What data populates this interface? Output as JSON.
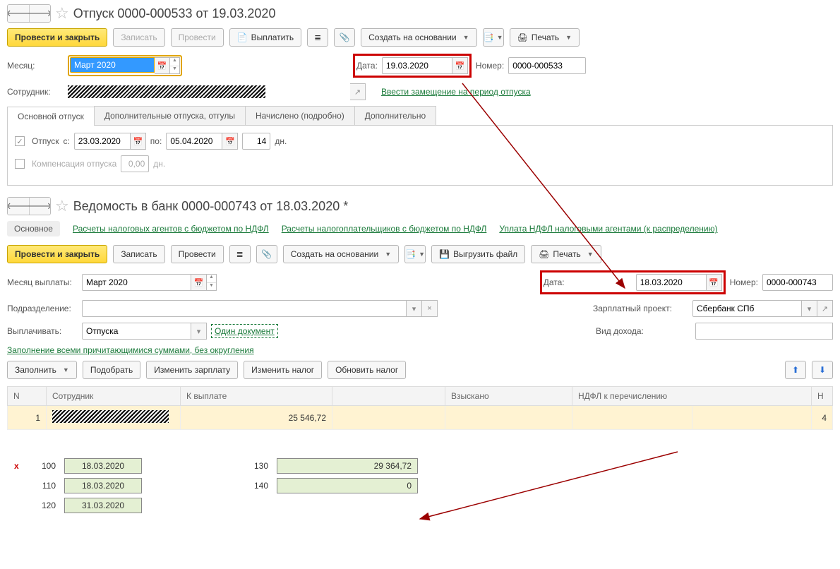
{
  "doc1": {
    "title": "Отпуск 0000-000533 от 19.03.2020",
    "toolbar": {
      "post_close": "Провести и закрыть",
      "write": "Записать",
      "post": "Провести",
      "pay": "Выплатить",
      "create_based": "Создать на основании",
      "print": "Печать"
    },
    "labels": {
      "month": "Месяц:",
      "date": "Дата:",
      "number": "Номер:",
      "employee": "Сотрудник:"
    },
    "month_value": "Март 2020",
    "date_value": "19.03.2020",
    "number_value": "0000-000533",
    "subst_link": "Ввести замещение на период отпуска",
    "tabs": [
      "Основной отпуск",
      "Дополнительные отпуска, отгулы",
      "Начислено (подробно)",
      "Дополнительно"
    ],
    "tab1": {
      "vacation_label": "Отпуск",
      "from_lbl": "с:",
      "to_lbl": "по:",
      "from": "23.03.2020",
      "to": "05.04.2020",
      "days": "14",
      "days_suffix": "дн.",
      "comp_label": "Компенсация отпуска",
      "comp_value": "0,00",
      "comp_suffix": "дн."
    }
  },
  "doc2": {
    "title": "Ведомость в банк 0000-000743 от 18.03.2020 *",
    "navlinks": {
      "main": "Основное",
      "l1": "Расчеты налоговых агентов с бюджетом по НДФЛ",
      "l2": "Расчеты налогоплательщиков с бюджетом по НДФЛ",
      "l3": "Уплата НДФЛ налоговыми агентами (к распределению)"
    },
    "toolbar": {
      "post_close": "Провести и закрыть",
      "write": "Записать",
      "post": "Провести",
      "create_based": "Создать на основании",
      "unload": "Выгрузить файл",
      "print": "Печать"
    },
    "labels": {
      "pay_month": "Месяц выплаты:",
      "date": "Дата:",
      "number": "Номер:",
      "dept": "Подразделение:",
      "proj": "Зарплатный проект:",
      "pay_what": "Выплачивать:",
      "income_type": "Вид дохода:"
    },
    "pay_month": "Март 2020",
    "date": "18.03.2020",
    "number": "0000-000743",
    "proj": "Сбербанк СПб",
    "pay_what": "Отпуска",
    "one_doc_link": "Один документ",
    "fill_link": "Заполнение всеми причитающимися суммами, без округления",
    "subtoolbar": {
      "fill": "Заполнить",
      "pick": "Подобрать",
      "change_salary": "Изменить зарплату",
      "change_tax": "Изменить налог",
      "update_tax": "Обновить налог"
    },
    "table": {
      "cols": [
        "N",
        "Сотрудник",
        "К выплате",
        "",
        "Взыскано",
        "НДФЛ к перечислению",
        "",
        "Н"
      ],
      "row": {
        "n": "1",
        "payout": "25 546,72",
        "trailing": "4"
      }
    }
  },
  "report": {
    "rows": [
      {
        "x": "x",
        "code": "100",
        "val": "18.03.2020",
        "code2": "130",
        "val2": "29 364,72"
      },
      {
        "x": "",
        "code": "110",
        "val": "18.03.2020",
        "code2": "140",
        "val2": "0"
      },
      {
        "x": "",
        "code": "120",
        "val": "31.03.2020"
      }
    ]
  }
}
